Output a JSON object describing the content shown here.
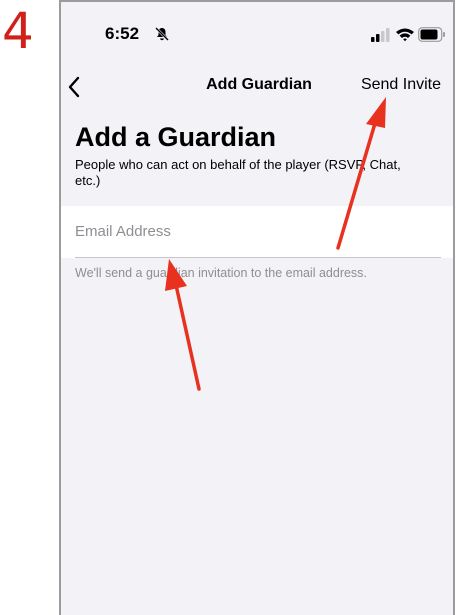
{
  "step": {
    "number": "4"
  },
  "status_bar": {
    "time": "6:52",
    "icons": [
      "bell-slash-icon",
      "signal-icon",
      "wifi-icon",
      "battery-icon"
    ]
  },
  "nav": {
    "title": "Add Guardian",
    "back_icon": "chevron-left-icon",
    "send_invite_label": "Send Invite"
  },
  "header": {
    "title": "Add a Guardian",
    "subtitle": "People who can act on behalf of the player (RSVP, Chat, etc.)"
  },
  "form": {
    "email_placeholder": "Email Address",
    "email_value": "",
    "helper": "We'll send a guardian invitation to the email address."
  },
  "annotations": {
    "arrow_color": "#e8311f",
    "number_color": "#d0201a"
  }
}
